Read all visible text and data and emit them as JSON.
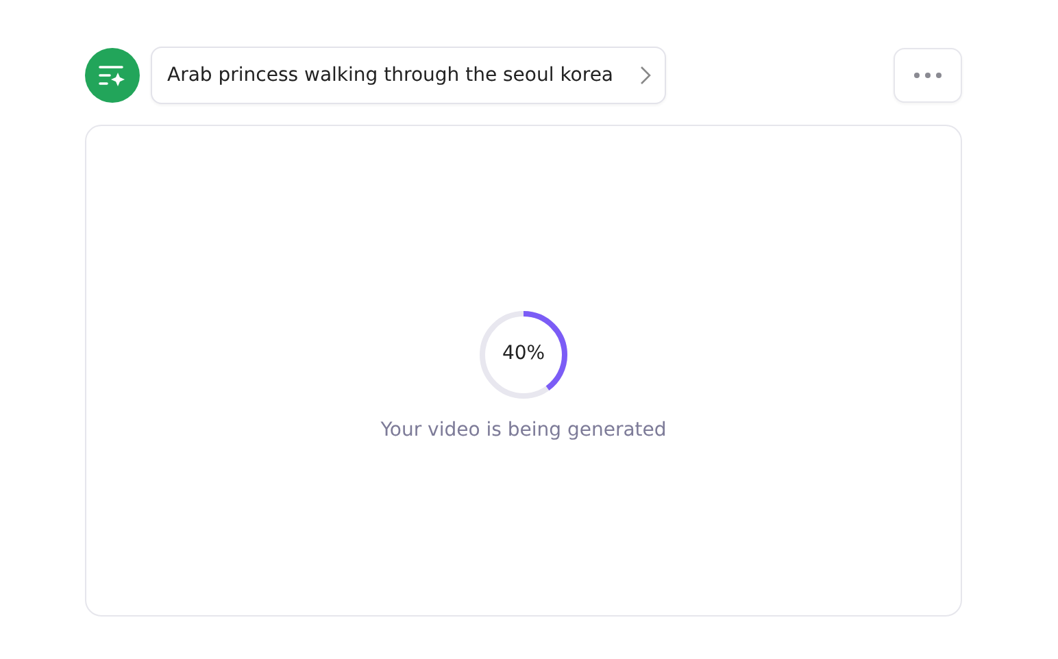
{
  "prompt": {
    "text": "Arab princess walking through the seoul korea"
  },
  "progress": {
    "reading": "40%",
    "message": "Your video is being generated"
  }
}
